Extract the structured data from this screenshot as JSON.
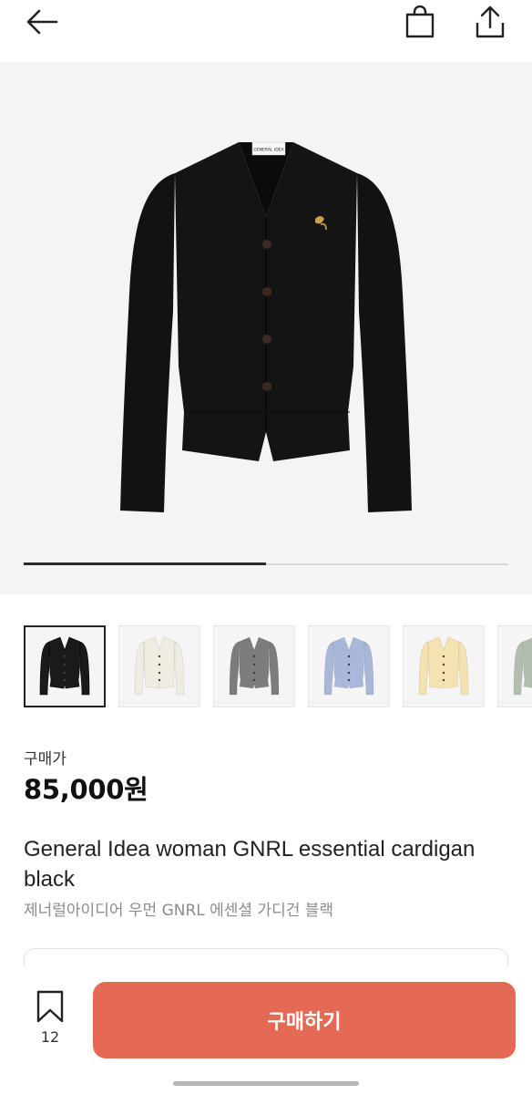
{
  "header": {
    "back_icon": "arrow-left-icon",
    "bag_icon": "shopping-bag-icon",
    "share_icon": "share-icon"
  },
  "product_image": {
    "label_text": "GENERAL IDEA",
    "progress_fraction": 0.5
  },
  "thumbnails": [
    {
      "color_name": "black",
      "color": "#1a1a1a",
      "selected": true
    },
    {
      "color_name": "ivory",
      "color": "#f0ece2",
      "selected": false
    },
    {
      "color_name": "gray",
      "color": "#7b7d7c",
      "selected": false
    },
    {
      "color_name": "light-blue",
      "color": "#a9b7d8",
      "selected": false
    },
    {
      "color_name": "butter-yellow",
      "color": "#f4e2b0",
      "selected": false
    },
    {
      "color_name": "sage",
      "color": "#b2bdb0",
      "selected": false
    }
  ],
  "price": {
    "label": "구매가",
    "value": "85,000원"
  },
  "product": {
    "title": "General Idea woman GNRL essential cardigan black",
    "subtitle": "제너럴아이디어 우먼 GNRL 에센셜 가디건 블랙"
  },
  "bottom_bar": {
    "wish_icon": "bookmark-icon",
    "wish_count": "12",
    "buy_label": "구매하기"
  },
  "colors": {
    "accent": "#e56a55",
    "text_primary": "#111111",
    "text_secondary": "#8c8c8c"
  }
}
